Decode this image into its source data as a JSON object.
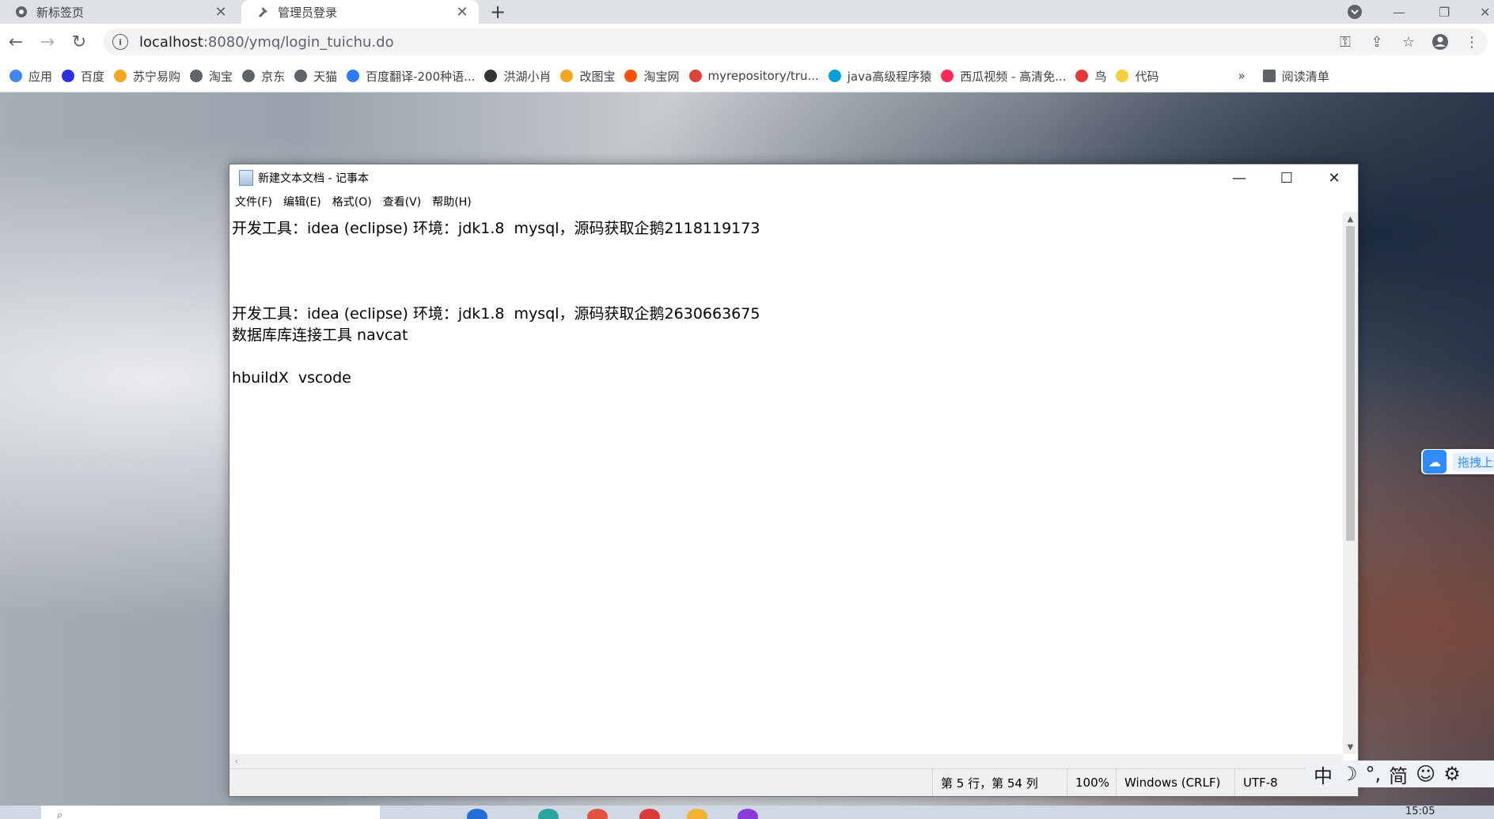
{
  "browser": {
    "tabs": [
      {
        "title": "新标签页",
        "active": false
      },
      {
        "title": "管理员登录",
        "active": true
      }
    ],
    "new_tab_symbol": "+",
    "address": {
      "host": "localhost",
      "path": ":8080/ymq/login_tuichu.do"
    },
    "bookmarks": [
      {
        "label": "应用",
        "icon": "apps-grid-icon",
        "color": "#4285f4"
      },
      {
        "label": "百度",
        "icon": "baidu-paw-icon",
        "color": "#2932e1"
      },
      {
        "label": "苏宁易购",
        "icon": "suning-icon",
        "color": "#f5a623"
      },
      {
        "label": "淘宝",
        "icon": "globe-icon",
        "color": "#5f6368"
      },
      {
        "label": "京东",
        "icon": "globe-icon",
        "color": "#5f6368"
      },
      {
        "label": "天猫",
        "icon": "globe-icon",
        "color": "#5f6368"
      },
      {
        "label": "百度翻译-200种语...",
        "icon": "translate-icon",
        "color": "#2f7cf6"
      },
      {
        "label": "洪湖小肖",
        "icon": "pen-icon",
        "color": "#333333"
      },
      {
        "label": "改图宝",
        "icon": "image-edit-icon",
        "color": "#f5a623"
      },
      {
        "label": "淘宝网",
        "icon": "taobao-icon",
        "color": "#ff5000"
      },
      {
        "label": "myrepository/tru...",
        "icon": "chrome-icon",
        "color": "#db4437"
      },
      {
        "label": "java高级程序猿",
        "icon": "bilibili-icon",
        "color": "#00a1d6"
      },
      {
        "label": "西瓜视频 - 高清免...",
        "icon": "xigua-icon",
        "color": "#fe2c55"
      },
      {
        "label": "鸟",
        "icon": "bird-icon",
        "color": "#e53935"
      },
      {
        "label": "代码",
        "icon": "moon-icon",
        "color": "#f4d03f"
      }
    ],
    "bookmarks_overflow": "»",
    "reading_list": "阅读清单"
  },
  "notepad": {
    "title": "新建文本文档 - 记事本",
    "menu": [
      "文件(F)",
      "编辑(E)",
      "格式(O)",
      "查看(V)",
      "帮助(H)"
    ],
    "lines": [
      "开发工具：idea (eclipse) 环境：jdk1.8  mysql，源码获取企鹅2118119173",
      "",
      "",
      "",
      "开发工具：idea (eclipse) 环境：jdk1.8  mysql，源码获取企鹅2630663675",
      "数据库库连接工具 navcat",
      "",
      "hbuildX  vscode"
    ],
    "status": {
      "position": "第 5 行，第 54 列",
      "zoom": "100%",
      "line_ending": "Windows (CRLF)",
      "encoding": "UTF-8"
    }
  },
  "baidu_float": {
    "label": "拖拽上传"
  },
  "ime": {
    "items": [
      "中",
      "☽",
      "°,",
      "简",
      "☺",
      "⚙"
    ]
  },
  "taskbar": {
    "clock": "15:05"
  }
}
